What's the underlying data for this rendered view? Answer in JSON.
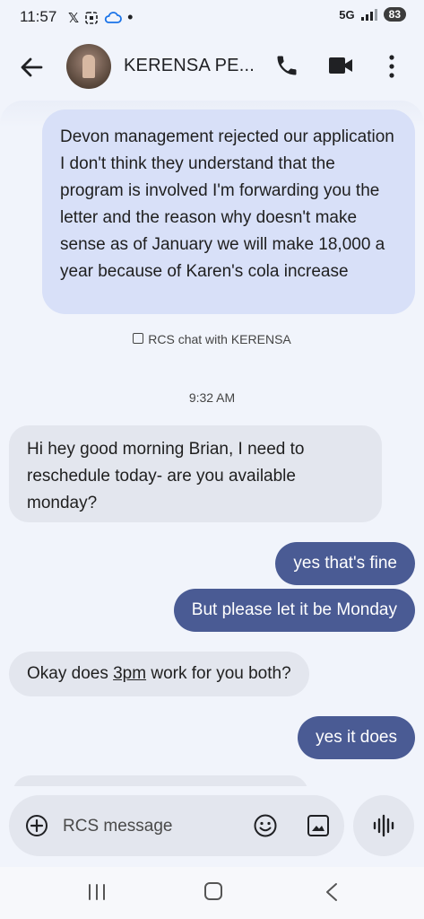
{
  "status_bar": {
    "time": "11:57",
    "left_icons": [
      "x-icon",
      "screenshot-icon",
      "cloud-icon",
      "dot-icon"
    ],
    "network": "5G",
    "battery": "83"
  },
  "header": {
    "contact_name": "KERENSA PE...",
    "actions": [
      "call-icon",
      "video-icon",
      "more-icon"
    ]
  },
  "messages": [
    {
      "direction": "outgoing",
      "text": "Devon management rejected our application I don't think they understand that the program is involved I'm forwarding you the letter and the reason why doesn't make sense as of January we will make 18,000 a year because of Karen's cola increase"
    },
    {
      "direction": "incoming",
      "text": "Hi hey good morning Brian, I need to reschedule today- are you available monday?"
    },
    {
      "direction": "outgoing",
      "text": "yes that's fine"
    },
    {
      "direction": "outgoing",
      "text": "But please let it be Monday"
    },
    {
      "direction": "incoming",
      "text_before": "Okay does ",
      "text_link": "3pm",
      "text_after": " work for you both?"
    },
    {
      "direction": "outgoing",
      "text": "yes it does"
    }
  ],
  "rcs_note": "RCS chat with KERENSA",
  "timestamp": "9:32 AM",
  "compose": {
    "placeholder": "RCS message"
  },
  "colors": {
    "background": "#f1f4fb",
    "outgoing_light": "#d8e0f8",
    "outgoing_dark": "#4a5b94",
    "incoming": "#e3e6ee"
  }
}
